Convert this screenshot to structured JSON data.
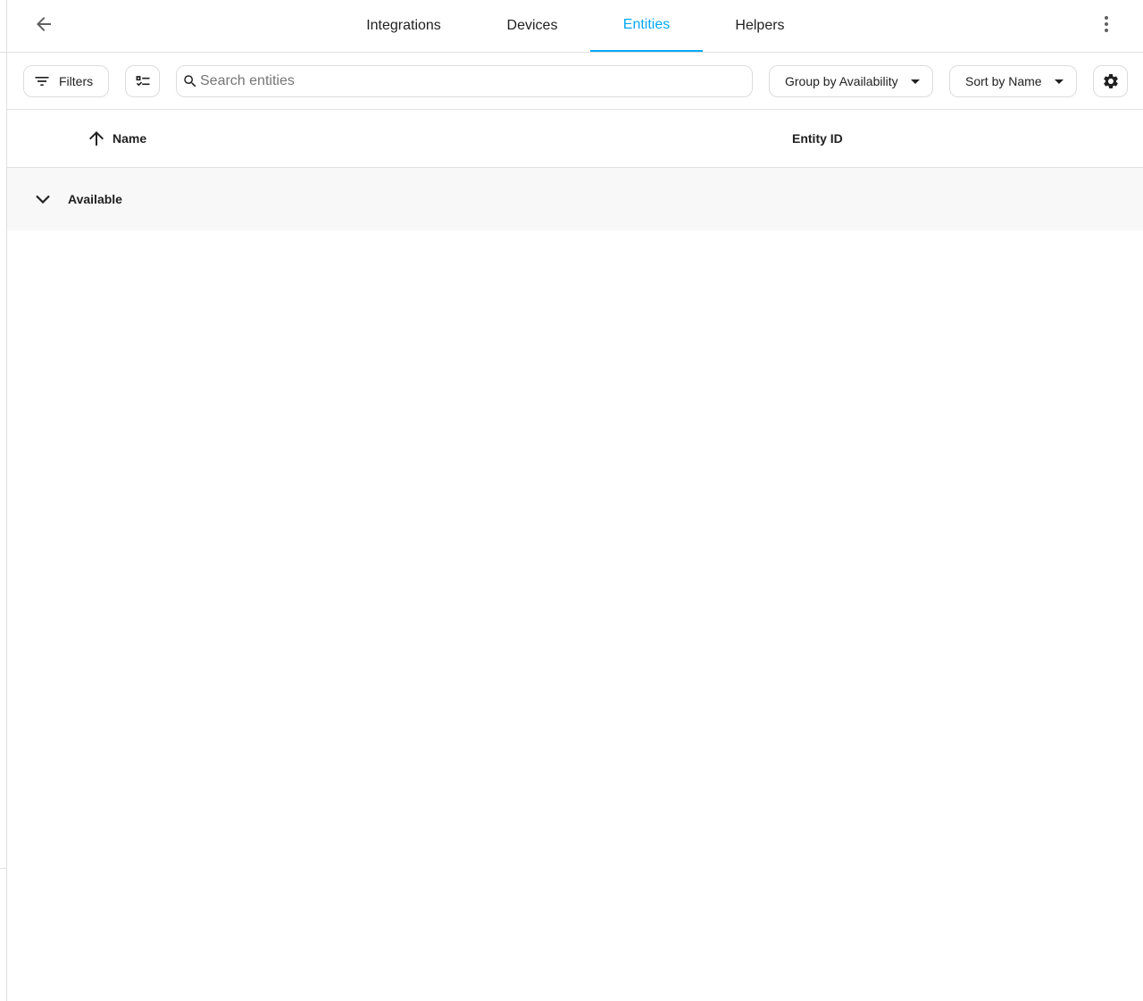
{
  "header": {
    "tabs": [
      {
        "label": "Integrations",
        "active": false
      },
      {
        "label": "Devices",
        "active": false
      },
      {
        "label": "Entities",
        "active": true
      },
      {
        "label": "Helpers",
        "active": false
      }
    ],
    "back_icon": "arrow-left-icon",
    "more_icon": "dots-vertical-icon",
    "accent_color": "#03a9f4"
  },
  "toolbar": {
    "filters_label": "Filters",
    "select_icon": "format-list-checks-icon",
    "search_placeholder": "Search entities",
    "search_value": "",
    "group_by_label": "Group by Availability",
    "sort_by_label": "Sort by Name",
    "settings_icon": "gear-icon"
  },
  "table": {
    "columns": [
      {
        "label": "Name",
        "sort": "ascending"
      },
      {
        "label": "Entity ID"
      }
    ],
    "groups": [
      {
        "label": "Available",
        "expanded": true,
        "rows": []
      }
    ]
  }
}
